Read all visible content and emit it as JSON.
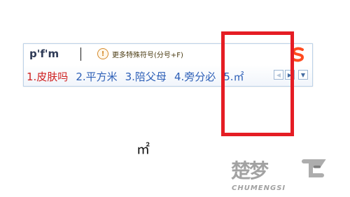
{
  "ime": {
    "composition": "p'f'm",
    "hint_icon": "info-icon",
    "hint_text": "更多特殊符号(分号+F)",
    "logo_text": "S",
    "candidates": [
      {
        "label": "1.皮肤吗",
        "selected": true
      },
      {
        "label": "2.平方米",
        "selected": false
      },
      {
        "label": "3.陪父母",
        "selected": false
      },
      {
        "label": "4.旁分必",
        "selected": false
      },
      {
        "label": "5.㎡",
        "selected": false
      }
    ],
    "nav_prev_icon": "chevron-left-icon",
    "nav_next_icon": "chevron-right-icon",
    "menu_icon": "chevron-down-icon"
  },
  "result_symbol": "㎡",
  "watermark": {
    "chinese_text": "楚梦",
    "english_text": "CHUMENGSI"
  },
  "colors": {
    "highlight_border": "#e51d24",
    "selected_candidate": "#cf1f1f",
    "candidate_text": "#2d5fb7",
    "ime_border": "#bcd2e8"
  }
}
